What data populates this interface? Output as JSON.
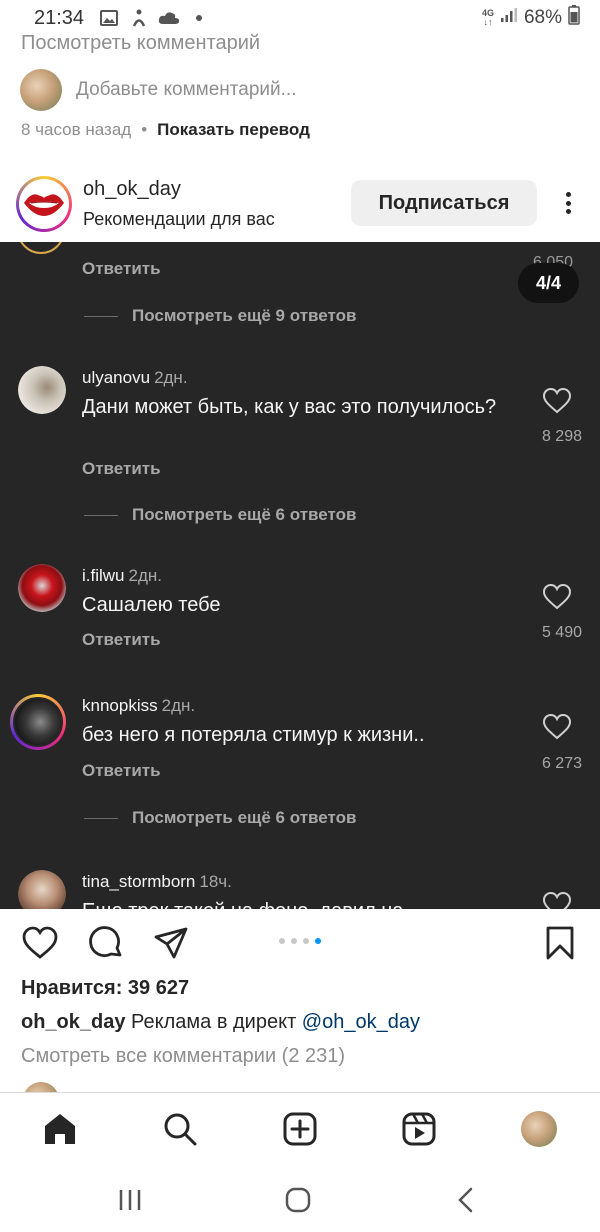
{
  "status_bar": {
    "time": "21:34",
    "network": "4G",
    "battery": "68%"
  },
  "previous_post": {
    "view_comments": "Посмотреть комментарий",
    "add_comment_placeholder": "Добавьте комментарий...",
    "time_ago": "8 часов назад",
    "separator": "•",
    "show_translation": "Показать перевод"
  },
  "post_header": {
    "username": "oh_ok_day",
    "subtitle": "Рекомендации для вас",
    "follow_label": "Подписаться"
  },
  "media": {
    "counter": "4/4",
    "top_partial": {
      "likes": "6 050",
      "reply_label": "Ответить",
      "view_more": "Посмотреть ещё 9 ответов"
    },
    "comments": [
      {
        "user": "ulyanovu",
        "time": "2дн.",
        "text": "Дани может быть, как у вас это получилось?",
        "likes": "8 298",
        "reply_label": "Ответить",
        "view_more": "Посмотреть ещё 6 ответов"
      },
      {
        "user": "i.filwu",
        "time": "2дн.",
        "text": "Сашалею тебе",
        "likes": "5 490",
        "reply_label": "Ответить"
      },
      {
        "user": "knnopkiss",
        "time": "2дн.",
        "text": "без него я потеряла стимур к жизни..",
        "likes": "6 273",
        "reply_label": "Ответить",
        "view_more": "Посмотреть ещё 6 ответов"
      },
      {
        "user": "tina_stormborn",
        "time": "18ч.",
        "text": "Еще трек такой на фоне, давил на"
      }
    ]
  },
  "post_footer": {
    "likes": "Нравится: 39 627",
    "caption_user": "oh_ok_day",
    "caption_text": "Реклама в директ",
    "caption_mention": "@oh_ok_day",
    "view_all_comments": "Смотреть все комментарии (2 231)"
  },
  "colors": {
    "accent": "#0095f6",
    "dark_bg": "#262626",
    "muted": "#8e8e8e"
  }
}
